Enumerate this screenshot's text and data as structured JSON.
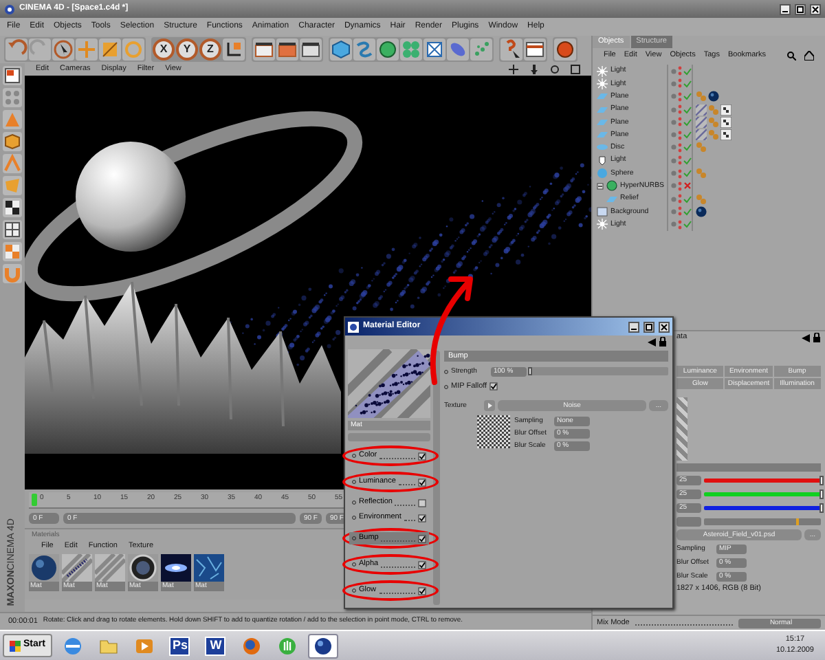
{
  "window": {
    "title": "CINEMA 4D - [Space1.c4d *]"
  },
  "menu": [
    "File",
    "Edit",
    "Objects",
    "Tools",
    "Selection",
    "Structure",
    "Functions",
    "Animation",
    "Character",
    "Dynamics",
    "Hair",
    "Render",
    "Plugins",
    "Window",
    "Help"
  ],
  "toolbar": {
    "axis_buttons": [
      "X",
      "Y",
      "Z"
    ]
  },
  "viewport": {
    "menu": [
      "Edit",
      "Cameras",
      "Display",
      "Filter",
      "View"
    ]
  },
  "timeline": {
    "ticks": [
      "0",
      "5",
      "10",
      "15",
      "20",
      "25",
      "30",
      "35",
      "40",
      "45",
      "50",
      "55"
    ],
    "level": 0,
    "start_field": "0 F",
    "range_start": "0 F",
    "range_end": "90 F",
    "end_field": "90 F"
  },
  "materials": {
    "title": "Materials",
    "menu": [
      "File",
      "Edit",
      "Function",
      "Texture"
    ],
    "items": [
      {
        "kind": "sphere",
        "label": "Mat"
      },
      {
        "kind": "stripes-dots",
        "label": "Mat"
      },
      {
        "kind": "stripes",
        "label": "Mat"
      },
      {
        "kind": "ring",
        "label": "Mat"
      },
      {
        "kind": "nebula",
        "label": "Mat"
      },
      {
        "kind": "texture",
        "label": "Mat"
      }
    ]
  },
  "brand": {
    "maker": "MAXON",
    "product": "CINEMA 4D"
  },
  "status_bar": {
    "time": "00:00:01",
    "message": "Rotate: Click and drag to rotate elements. Hold down SHIFT to add to quantize rotation / add to the selection in point mode, CTRL to remove."
  },
  "objects_panel": {
    "tabs": [
      {
        "label": "Objects",
        "selected": true
      },
      {
        "label": "Structure",
        "selected": false
      }
    ],
    "menu": [
      "File",
      "Edit",
      "View",
      "Objects",
      "Tags",
      "Bookmarks"
    ],
    "items": [
      {
        "name": "Light",
        "kind": "light",
        "enabled": true
      },
      {
        "name": "Light",
        "kind": "light",
        "enabled": true
      },
      {
        "name": "Plane",
        "kind": "plane",
        "enabled": true,
        "tags": [
          {
            "kind": "phong"
          },
          {
            "kind": "material"
          }
        ]
      },
      {
        "name": "Plane",
        "kind": "plane",
        "enabled": true,
        "tags": [
          {
            "kind": "texture"
          },
          {
            "kind": "phong"
          },
          {
            "kind": "display"
          }
        ]
      },
      {
        "name": "Plane",
        "kind": "plane",
        "enabled": true,
        "tags": [
          {
            "kind": "texture"
          },
          {
            "kind": "phong"
          },
          {
            "kind": "display"
          }
        ]
      },
      {
        "name": "Plane",
        "kind": "plane",
        "enabled": true,
        "tags": [
          {
            "kind": "texture"
          },
          {
            "kind": "phong"
          },
          {
            "kind": "display"
          }
        ]
      },
      {
        "name": "Disc",
        "kind": "disc",
        "enabled": true,
        "tags": [
          {
            "kind": "phong"
          }
        ]
      },
      {
        "name": "Light",
        "kind": "spot",
        "enabled": true
      },
      {
        "name": "Sphere",
        "kind": "sphere",
        "enabled": true,
        "tags": [
          {
            "kind": "phong"
          }
        ]
      },
      {
        "name": "HyperNURBS",
        "kind": "nurbs",
        "enabled": false,
        "expanded": true,
        "children": [
          {
            "name": "Relief",
            "kind": "plane",
            "enabled": true,
            "tags": [
              {
                "kind": "phong"
              }
            ]
          }
        ]
      },
      {
        "name": "Background",
        "kind": "background",
        "enabled": true,
        "tags": [
          {
            "kind": "material"
          }
        ]
      },
      {
        "name": "Light",
        "kind": "light",
        "enabled": true
      }
    ]
  },
  "attributes": {
    "header": "ata",
    "tabs": [
      {
        "label": "Luminance",
        "selected": false
      },
      {
        "label": "Environment",
        "selected": false
      },
      {
        "label": "Bump",
        "selected": false
      },
      {
        "label": "Glow",
        "selected": false
      },
      {
        "label": "Displacement",
        "selected": false
      },
      {
        "label": "Illumination",
        "selected": false
      }
    ],
    "channels": [
      {
        "value": "25",
        "color": "#e01010",
        "level": 1
      },
      {
        "value": "25",
        "color": "#10d020",
        "level": 1
      },
      {
        "value": "25",
        "color": "#1020e0",
        "level": 1
      }
    ],
    "brightness": {
      "level": 0.8
    },
    "texture": "Asteroid_Field_v01.psd",
    "browse": "...",
    "sampling": {
      "label": "Sampling",
      "value": "MIP"
    },
    "blur_offset": {
      "label": "Blur Offset",
      "value": "0 %"
    },
    "blur_scale": {
      "label": "Blur Scale",
      "value": "0 %"
    },
    "info": "1827 x 1406, RGB (8 Bit)",
    "mix_mode": {
      "label": "Mix Mode",
      "value": "Normal"
    }
  },
  "material_editor": {
    "title": "Material Editor",
    "name": "Mat",
    "channels": [
      {
        "label": "Color",
        "checked": true,
        "selected": false,
        "circled": true
      },
      {
        "label": "Luminance",
        "checked": true,
        "selected": false,
        "circled": true
      },
      {
        "label": "Reflection",
        "checked": false,
        "selected": false,
        "circled": false
      },
      {
        "label": "Environment",
        "checked": true,
        "selected": false,
        "circled": false
      },
      {
        "label": "Bump",
        "checked": true,
        "selected": true,
        "circled": true
      },
      {
        "label": "Alpha",
        "checked": true,
        "selected": false,
        "circled": true
      },
      {
        "label": "Glow",
        "checked": true,
        "selected": false,
        "circled": true
      }
    ],
    "section": "Bump",
    "strength": {
      "label": "Strength",
      "value": "100 %",
      "level": 0
    },
    "mip_falloff": {
      "label": "MIP Falloff",
      "checked": true
    },
    "texture": {
      "label": "Texture",
      "shader": "Noise",
      "browse": "..."
    },
    "sampling": {
      "label": "Sampling",
      "value": "None"
    },
    "blur_offset": {
      "label": "Blur Offset",
      "value": "0 %"
    },
    "blur_scale": {
      "label": "Blur Scale",
      "value": "0 %"
    },
    "annotation_arrow": true
  },
  "taskbar": {
    "start": "Start",
    "apps": [
      {
        "kind": "browser",
        "selected": false
      },
      {
        "kind": "folder",
        "selected": false
      },
      {
        "kind": "media",
        "selected": false
      },
      {
        "kind": "letter",
        "label": "Ps",
        "selected": false
      },
      {
        "kind": "letter",
        "label": "W",
        "selected": false
      },
      {
        "kind": "globe",
        "selected": false
      },
      {
        "kind": "hand",
        "selected": false
      },
      {
        "kind": "sphere",
        "selected": true
      }
    ],
    "clock": "15:17",
    "date": "10.12.2009"
  }
}
